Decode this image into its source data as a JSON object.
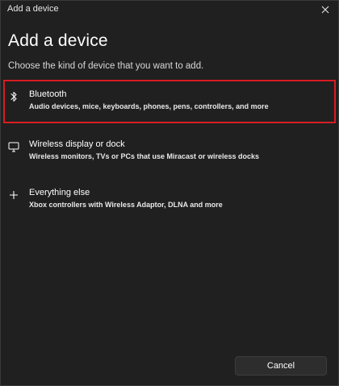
{
  "window": {
    "title": "Add a device"
  },
  "heading": "Add a device",
  "subtitle": "Choose the kind of device that you want to add.",
  "options": [
    {
      "label": "Bluetooth",
      "description": "Audio devices, mice, keyboards, phones, pens, controllers, and more",
      "icon": "bluetooth-icon",
      "selected": true
    },
    {
      "label": "Wireless display or dock",
      "description": "Wireless monitors, TVs or PCs that use Miracast or wireless docks",
      "icon": "monitor-icon",
      "selected": false
    },
    {
      "label": "Everything else",
      "description": "Xbox controllers with Wireless Adaptor, DLNA and more",
      "icon": "plus-icon",
      "selected": false
    }
  ],
  "buttons": {
    "cancel": "Cancel"
  },
  "colors": {
    "background": "#202020",
    "selection_border": "#d81c22"
  }
}
